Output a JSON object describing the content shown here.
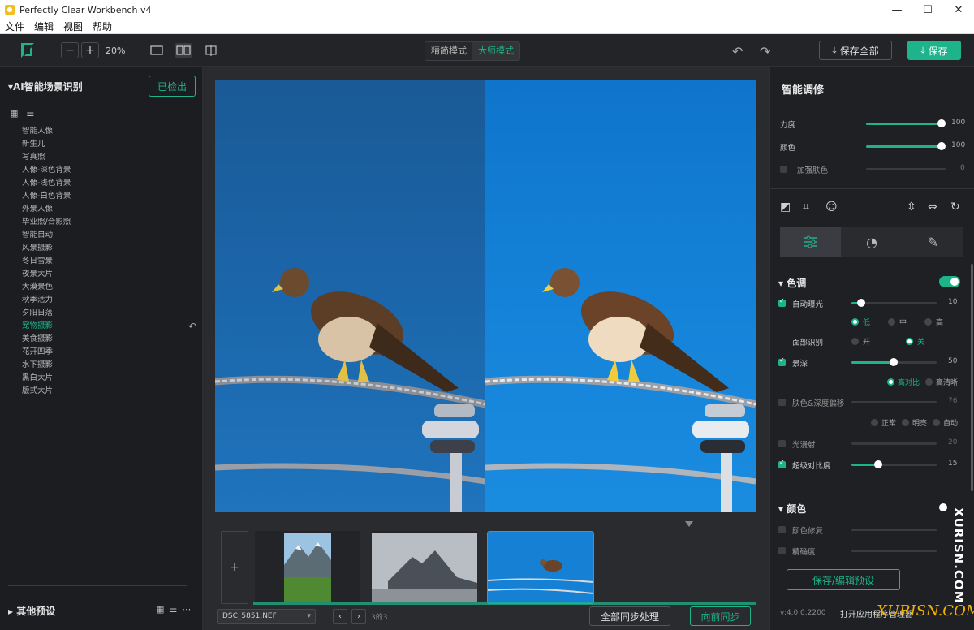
{
  "window": {
    "title": "Perfectly Clear Workbench v4",
    "minimize": "—",
    "maximize": "☐",
    "close": "✕"
  },
  "menu": [
    "文件",
    "编辑",
    "视图",
    "帮助"
  ],
  "toolbar": {
    "zoom_out": "−",
    "zoom_in": "+",
    "zoom_level": "20%",
    "modes": [
      "精简模式",
      "大师模式"
    ],
    "active_mode": "大师模式",
    "undo_icon": "↶",
    "redo_icon": "↷",
    "save_all_label": "保存全部",
    "save_label": "保存"
  },
  "left_panel": {
    "title": "▾AI智能场景识别",
    "detected_button": "已检出",
    "scenes": [
      "智能人像",
      "新生儿",
      "写真照",
      "人像-深色背景",
      "人像-浅色背景",
      "人像-白色背景",
      "外景人像",
      "毕业照/合影照",
      "智能自动",
      "风景摄影",
      "冬日雪景",
      "夜景大片",
      "大漠景色",
      "秋季活力",
      "夕阳日落",
      "宠物摄影",
      "美食摄影",
      "花开四季",
      "水下摄影",
      "黑白大片",
      "版式大片"
    ],
    "active_scene": "宠物摄影",
    "other_presets": "▸  其他预设"
  },
  "center": {
    "file_name": "DSC_5851.NEF",
    "count": "3的3",
    "prev": "‹",
    "next": "›",
    "add_label": "+",
    "sync_all_label": "全部同步处理",
    "sync_prev_label": "向前同步"
  },
  "right_panel": {
    "title": "智能调修",
    "strength": {
      "label": "力度",
      "value": "100"
    },
    "color": {
      "label": "颜色",
      "value": "100"
    },
    "skin": {
      "label": "加强肤色",
      "value": "0"
    },
    "tone_section": "色调",
    "auto_exposure": {
      "label": "自动曝光",
      "value": "10",
      "options": [
        "低",
        "中",
        "高"
      ],
      "selected": "低"
    },
    "face_detect": {
      "label": "面部识别",
      "options": [
        "开",
        "关"
      ],
      "selected": "关"
    },
    "depth": {
      "label": "景深",
      "value": "50",
      "options": [
        "高对比",
        "高清晰"
      ],
      "selected": "高对比"
    },
    "skin_depth": {
      "label": "肤色&深度偏移",
      "value": "76",
      "options": [
        "正常",
        "明亮",
        "自动"
      ]
    },
    "light_diffuse": {
      "label": "光漫射",
      "value": "20"
    },
    "super_contrast": {
      "label": "超级对比度",
      "value": "15"
    },
    "color_section": "颜色",
    "color_fix": {
      "label": "颜色修复"
    },
    "accuracy": {
      "label": "精确度"
    },
    "preset_button": "保存/编辑预设",
    "version": "v:4.0.0.2200",
    "open_text": "打开应用程序管理器"
  },
  "watermark": {
    "vertical": "XURISN.COM",
    "horizontal": "XURISN.COM"
  }
}
